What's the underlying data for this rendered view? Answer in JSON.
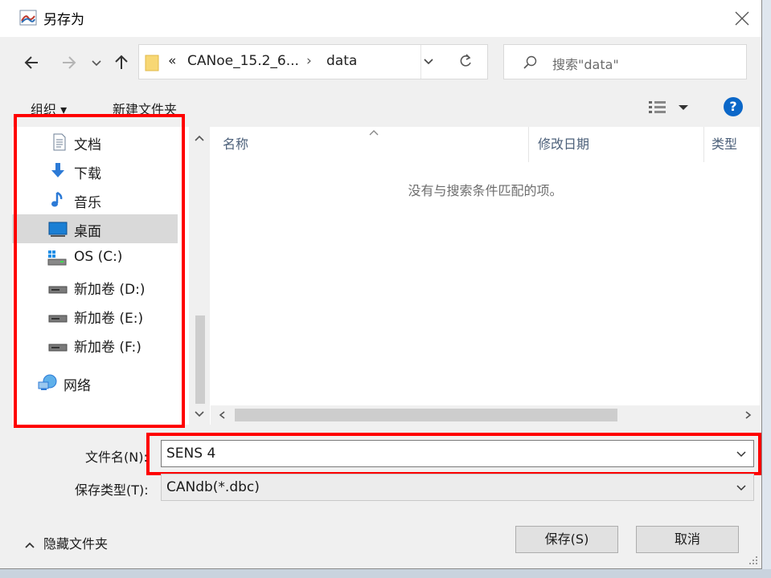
{
  "dialog": {
    "title": "另存为",
    "colors": {
      "accent": "#0b67c8",
      "highlight_box": "#ff0000",
      "selected_row": "#d9d9d9"
    }
  },
  "navigation": {
    "back_icon": "back-arrow-icon",
    "forward_icon": "forward-arrow-icon",
    "recent_icon": "chevron-down-icon",
    "up_icon": "up-arrow-icon"
  },
  "address": {
    "overflow": "«",
    "segments": [
      "CANoe_15.2_6...",
      "data"
    ],
    "separator": "›"
  },
  "search": {
    "placeholder": "搜索\"data\""
  },
  "toolbar": {
    "organize": "组织 ▾",
    "new_folder": "新建文件夹"
  },
  "sidebar": {
    "items": [
      {
        "label": "文档",
        "icon": "document-icon"
      },
      {
        "label": "下载",
        "icon": "download-icon"
      },
      {
        "label": "音乐",
        "icon": "music-icon"
      },
      {
        "label": "桌面",
        "icon": "desktop-icon",
        "selected": true
      },
      {
        "label": "OS (C:)",
        "icon": "system-drive-icon"
      },
      {
        "label": "新加卷 (D:)",
        "icon": "drive-icon"
      },
      {
        "label": "新加卷 (E:)",
        "icon": "drive-icon"
      },
      {
        "label": "新加卷 (F:)",
        "icon": "drive-icon"
      },
      {
        "label": "网络",
        "icon": "network-icon"
      }
    ]
  },
  "file_list": {
    "columns": [
      "名称",
      "修改日期",
      "类型"
    ],
    "empty_message": "没有与搜索条件匹配的项。"
  },
  "form": {
    "filename_label": "文件名(N):",
    "filename_value": "SENS 4",
    "filetype_label": "保存类型(T):",
    "filetype_value": "CANdb(*.dbc)"
  },
  "footer": {
    "hide_folders": "隐藏文件夹",
    "save": "保存(S)",
    "cancel": "取消"
  }
}
